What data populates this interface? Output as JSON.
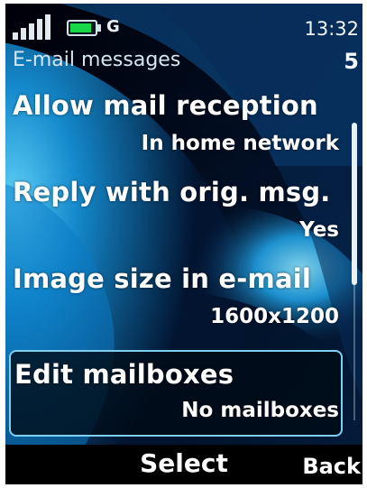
{
  "status": {
    "signal_icon": "signal-strength-icon",
    "battery_icon": "battery-icon",
    "battery_level": 0.9,
    "network": "G",
    "time": "13:32"
  },
  "header": {
    "title": "E-mail messages",
    "count": "5"
  },
  "settings": {
    "items": [
      {
        "label": "Allow mail reception",
        "value": "In home network"
      },
      {
        "label": "Reply with orig. msg.",
        "value": "Yes"
      },
      {
        "label": "Image size in e-mail",
        "value": "1600x1200"
      },
      {
        "label": "Edit mailboxes",
        "value": "No mailboxes"
      }
    ],
    "selected_index": 3
  },
  "softkeys": {
    "center": "Select",
    "right": "Back"
  },
  "colors": {
    "wallpaper_dark": "#00050f",
    "wallpaper_blue": "#1aa8e8",
    "highlight_border": "#7fd0f0",
    "battery_fill": "#18d84a"
  }
}
